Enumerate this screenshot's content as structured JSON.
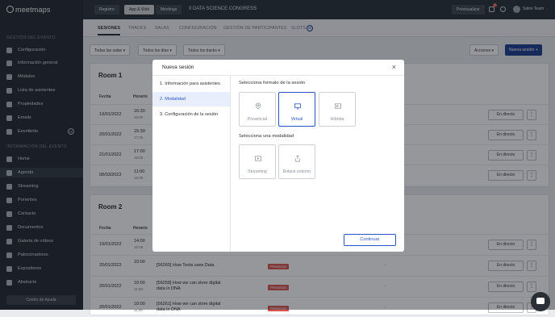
{
  "app": {
    "logo": "meetmaps"
  },
  "sidebar": {
    "section_event": "GESTIÓN DEL EVENTO",
    "event_items": [
      {
        "label": "Configuración",
        "icon": "gear-icon"
      },
      {
        "label": "Información general",
        "icon": "info-icon"
      },
      {
        "label": "Módulos",
        "icon": "modules-icon"
      },
      {
        "label": "Lista de asistentes",
        "icon": "users-icon"
      },
      {
        "label": "Propiedades",
        "icon": "properties-icon"
      },
      {
        "label": "Emails",
        "icon": "mail-icon"
      },
      {
        "label": "Eventbrite",
        "icon": "eventbrite-icon",
        "badge": "M"
      }
    ],
    "section_info": "INFORMACIÓN DEL EVENTO",
    "info_items": [
      {
        "label": "Home",
        "icon": "home-icon"
      },
      {
        "label": "Agenda",
        "icon": "calendar-icon"
      },
      {
        "label": "Streaming",
        "icon": "streaming-icon"
      },
      {
        "label": "Ponentes",
        "icon": "microphone-icon"
      },
      {
        "label": "Contacto",
        "icon": "chat-icon"
      },
      {
        "label": "Documentos",
        "icon": "document-icon"
      },
      {
        "label": "Galería de vídeos",
        "icon": "video-icon"
      },
      {
        "label": "Patrocinadores",
        "icon": "sponsor-icon"
      },
      {
        "label": "Expositores",
        "icon": "exhibitor-icon"
      },
      {
        "label": "Abstracts",
        "icon": "bookmark-icon"
      }
    ],
    "help": "Centro de Ayuda"
  },
  "topbar": {
    "tabs": [
      "Registro",
      "App & Web",
      "Meetings"
    ],
    "event_name": "II DATA SCIENCE CONGRESS",
    "preview": "Previsualizar",
    "notif_count": "1",
    "user": "Sales Team"
  },
  "subtabs": [
    "SESIONES",
    "TRACKS",
    "SALAS",
    "CONFIGURACIÓN",
    "GESTIÓN DE PARTICIPANTES",
    "SLOTS"
  ],
  "slots_badge": "M",
  "filters": [
    "Todas las salas",
    "Todos los días",
    "Todos los tracks"
  ],
  "actions_label": "Acciones",
  "new_session_label": "Nueva sesión",
  "rooms": [
    {
      "name": "Room 1",
      "headers": {
        "date": "Fecha",
        "time": "Horario"
      },
      "rows": [
        {
          "date": "19/01/2022",
          "time": "16:30",
          "end": "18:00"
        },
        {
          "date": "20/01/2022",
          "time": "15:30",
          "end": "17:00"
        },
        {
          "date": "21/01/2022",
          "time": "17:00",
          "end": "18:00"
        },
        {
          "date": "08/03/2022",
          "time": "11:00",
          "end": "15:00"
        }
      ]
    },
    {
      "name": "Room 2",
      "headers": {
        "date": "Fecha",
        "time": "Horario"
      },
      "rows": [
        {
          "date": "19/01/2022",
          "time": "14:00",
          "end": "15:00",
          "title": "",
          "tag": ""
        },
        {
          "date": "20/01/2022",
          "time": "10:00",
          "end": "",
          "title": "[56260] How Tesla uses Data",
          "tag": "Presencial"
        },
        {
          "date": "20/01/2022",
          "time": "10:00",
          "end": "11:00",
          "title": "[56259] How we can store digital data in DNA",
          "tag": "Presencial"
        },
        {
          "date": "20/01/2022",
          "time": "10:00",
          "end": "11:00",
          "title": "[56261] How we can store digital data in DNA",
          "tag": "Presencial"
        }
      ]
    }
  ],
  "live_label": "En directo",
  "more_label": "⋮",
  "modal": {
    "title": "Nueva sesión",
    "close": "×",
    "steps": [
      "1. Información para asistentes",
      "2. Modalidad",
      "3. Configuración de la sesión"
    ],
    "format_label": "Selecciona formato de la sesión",
    "formats": [
      {
        "label": "Presencial",
        "icon": "location-pin-icon",
        "selected": false
      },
      {
        "label": "Virtual",
        "icon": "monitor-icon",
        "selected": true
      },
      {
        "label": "Híbrida",
        "icon": "hybrid-icon",
        "selected": false
      }
    ],
    "modality_label": "Selecciona una modalidad",
    "modalities": [
      {
        "label": "Streaming",
        "icon": "play-icon"
      },
      {
        "label": "Enlace externo",
        "icon": "share-icon"
      }
    ],
    "continue": "Continuar"
  }
}
